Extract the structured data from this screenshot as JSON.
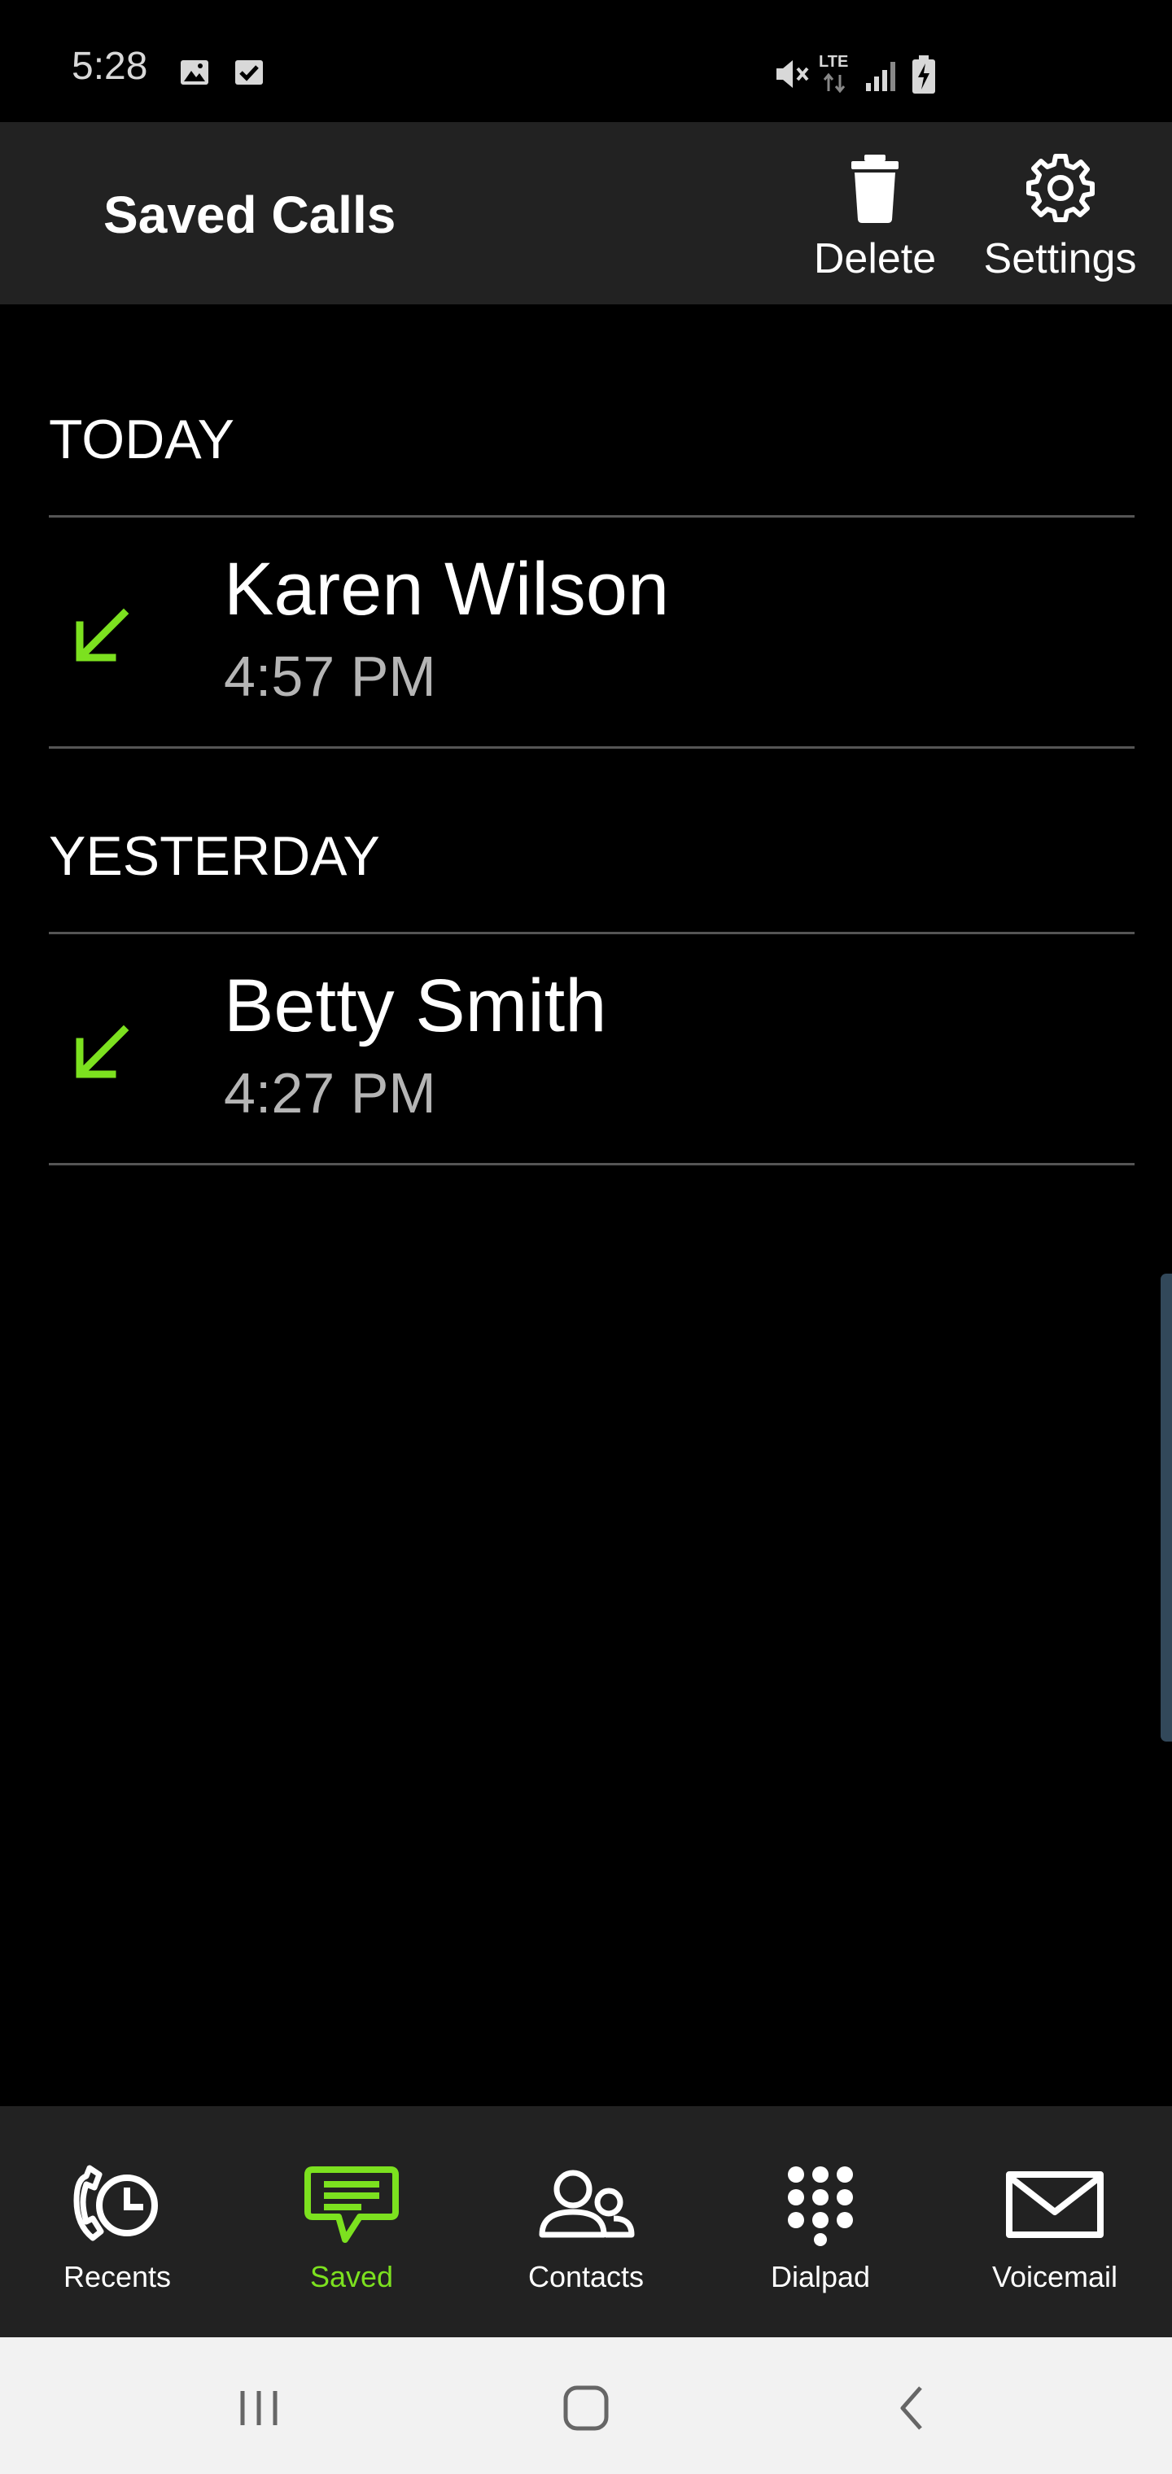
{
  "status_bar": {
    "time": "5:28",
    "left_icons": [
      "image-icon",
      "checkbox-icon"
    ],
    "right_icons": [
      "mute-icon",
      "lte-icon",
      "signal-icon",
      "battery-charging-icon"
    ],
    "network_label": "LTE"
  },
  "header": {
    "title": "Saved Calls",
    "actions": [
      {
        "label": "Delete",
        "icon": "trash-icon"
      },
      {
        "label": "Settings",
        "icon": "gear-icon"
      }
    ]
  },
  "sections": [
    {
      "header": "TODAY",
      "calls": [
        {
          "name": "Karen Wilson",
          "time": "4:57 PM",
          "type": "incoming",
          "icon": "incoming-call-arrow-icon"
        }
      ]
    },
    {
      "header": "YESTERDAY",
      "calls": [
        {
          "name": "Betty Smith",
          "time": "4:27 PM",
          "type": "incoming",
          "icon": "incoming-call-arrow-icon"
        }
      ]
    }
  ],
  "bottom_nav": {
    "items": [
      {
        "label": "Recents",
        "icon": "phone-clock-icon",
        "active": false
      },
      {
        "label": "Saved",
        "icon": "message-bubble-icon",
        "active": true
      },
      {
        "label": "Contacts",
        "icon": "people-icon",
        "active": false
      },
      {
        "label": "Dialpad",
        "icon": "dialpad-icon",
        "active": false
      },
      {
        "label": "Voicemail",
        "icon": "envelope-icon",
        "active": false
      }
    ]
  },
  "colors": {
    "accent": "#7ce11f",
    "background": "#000000",
    "bar_background": "#222222",
    "secondary_text": "#b5b5b5",
    "divider": "#555555"
  }
}
